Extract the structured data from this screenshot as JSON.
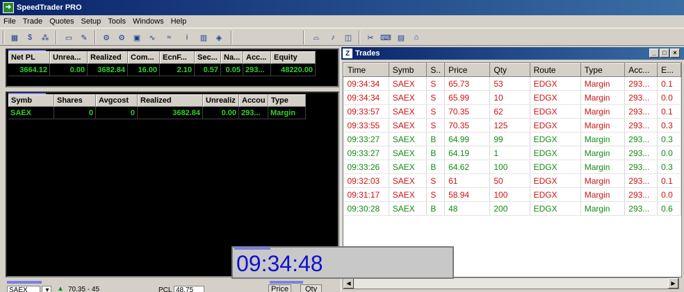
{
  "app": {
    "title": "SpeedTrader PRO"
  },
  "menu": [
    "File",
    "Trade",
    "Quotes",
    "Setup",
    "Tools",
    "Windows",
    "Help"
  ],
  "toolbar_icons": [
    "table-icon",
    "dollar-icon",
    "network-icon",
    "card-icon",
    "chart-icon",
    "gears-icon",
    "gears-icon",
    "monitor-icon",
    "sparkline-icon",
    "sparkline-icon",
    "info-icon",
    "bars-chart-icon",
    "tag-icon",
    "hat-icon",
    "bell-icon",
    "camera-icon",
    "scissors-icon",
    "keyboard-icon",
    "calculator-icon",
    "home-icon"
  ],
  "summary": {
    "headers": [
      "Net PL",
      "Unrea...",
      "Realized",
      "Com...",
      "EcnF...",
      "Sec...",
      "Na...",
      "Acc...",
      "Equity"
    ],
    "row": [
      "3664.12",
      "0.00",
      "3682.84",
      "16.00",
      "2.10",
      "0.57",
      "0.05",
      "293...",
      "48220.00"
    ]
  },
  "positions": {
    "headers": [
      "Symb",
      "Shares",
      "Avgcost",
      "Realized",
      "Unrealiz",
      "Accou",
      "Type"
    ],
    "row": [
      "SAEX",
      "0",
      "0",
      "3682.84",
      "0.00",
      "293...",
      "Margin"
    ]
  },
  "trades": {
    "title": "Trades",
    "columns": [
      "Time",
      "Symb",
      "S..",
      "Price",
      "Qty",
      "Route",
      "Type",
      "Acc...",
      "E..."
    ],
    "rows": [
      {
        "time": "09:34:34",
        "symb": "SAEX",
        "side": "S",
        "price": "65.73",
        "qty": "53",
        "route": "EDGX",
        "type": "Margin",
        "acct": "293...",
        "e": "0.1"
      },
      {
        "time": "09:34:34",
        "symb": "SAEX",
        "side": "S",
        "price": "65.99",
        "qty": "10",
        "route": "EDGX",
        "type": "Margin",
        "acct": "293...",
        "e": "0.0"
      },
      {
        "time": "09:33:57",
        "symb": "SAEX",
        "side": "S",
        "price": "70.35",
        "qty": "62",
        "route": "EDGX",
        "type": "Margin",
        "acct": "293...",
        "e": "0.1"
      },
      {
        "time": "09:33:55",
        "symb": "SAEX",
        "side": "S",
        "price": "70.35",
        "qty": "125",
        "route": "EDGX",
        "type": "Margin",
        "acct": "293...",
        "e": "0.3"
      },
      {
        "time": "09:33:27",
        "symb": "SAEX",
        "side": "B",
        "price": "64.99",
        "qty": "99",
        "route": "EDGX",
        "type": "Margin",
        "acct": "293...",
        "e": "0.3"
      },
      {
        "time": "09:33:27",
        "symb": "SAEX",
        "side": "B",
        "price": "64.19",
        "qty": "1",
        "route": "EDGX",
        "type": "Margin",
        "acct": "293...",
        "e": "0.0"
      },
      {
        "time": "09:33:26",
        "symb": "SAEX",
        "side": "B",
        "price": "64.62",
        "qty": "100",
        "route": "EDGX",
        "type": "Margin",
        "acct": "293...",
        "e": "0.3"
      },
      {
        "time": "09:32:03",
        "symb": "SAEX",
        "side": "S",
        "price": "61",
        "qty": "50",
        "route": "EDGX",
        "type": "Margin",
        "acct": "293...",
        "e": "0.1"
      },
      {
        "time": "09:31:17",
        "symb": "SAEX",
        "side": "S",
        "price": "58.94",
        "qty": "100",
        "route": "EDGX",
        "type": "Margin",
        "acct": "293...",
        "e": "0.0"
      },
      {
        "time": "09:30:28",
        "symb": "SAEX",
        "side": "B",
        "price": "48",
        "qty": "200",
        "route": "EDGX",
        "type": "Margin",
        "acct": "293...",
        "e": "0.6"
      }
    ]
  },
  "clock": {
    "time": "09:34:48"
  },
  "bottom": {
    "symbol": "SAEX",
    "quote": "70.35 - 45",
    "pcl_label": "PCL",
    "pcl_value": "48.75",
    "price_tab": "Price",
    "qty_tab": "Qty"
  },
  "colors": {
    "sell": "#d01010",
    "buy": "#128a12",
    "grid_text": "#2dd42d",
    "clock_text": "#1010d0",
    "tab_accent": "#7b7fe0"
  }
}
